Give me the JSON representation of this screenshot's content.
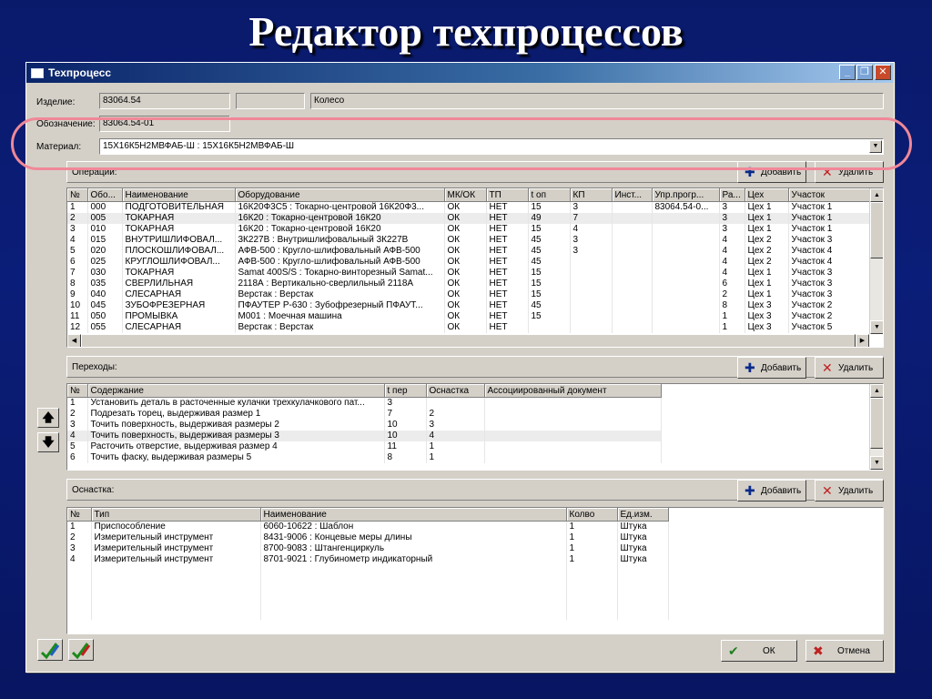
{
  "slide": {
    "title": "Редактор техпроцессов"
  },
  "window": {
    "title": "Техпроцесс"
  },
  "header": {
    "izdelie_label": "Изделие:",
    "izdelie_value": "83064.54",
    "izdelie_extra": "",
    "izdelie_name": "Колесо",
    "oboznachenie_label": "Обозначение:",
    "oboznachenie_value": "83064.54-01",
    "material_label": "Материал:",
    "material_value": "15Х16К5Н2МВФАБ-Ш : 15Х16К5Н2МВФАБ-Ш"
  },
  "buttons": {
    "add": "Добавить",
    "delete": "Удалить",
    "ok": "ОК",
    "cancel": "Отмена"
  },
  "operations": {
    "label": "Операции:",
    "columns": [
      "№",
      "Обо...",
      "Наименование",
      "Оборудование",
      "МК/ОК",
      "ТП",
      "t оп",
      "КП",
      "Инст...",
      "Упр.прогр...",
      "Ра...",
      "Цех",
      "Участок"
    ],
    "rows": [
      [
        "1",
        "000",
        "ПОДГОТОВИТЕЛЬНАЯ",
        "16К20Ф3С5 : Токарно-центровой 16К20Ф3...",
        "ОК",
        "НЕТ",
        "15",
        "3",
        "",
        "83064.54-0...",
        "3",
        "Цех 1",
        "Участок 1"
      ],
      [
        "2",
        "005",
        "ТОКАРНАЯ",
        "16К20 : Токарно-центровой 16К20",
        "ОК",
        "НЕТ",
        "49",
        "7",
        "",
        "",
        "3",
        "Цех 1",
        "Участок 1"
      ],
      [
        "3",
        "010",
        "ТОКАРНАЯ",
        "16К20 : Токарно-центровой 16К20",
        "ОК",
        "НЕТ",
        "15",
        "4",
        "",
        "",
        "3",
        "Цех 1",
        "Участок 1"
      ],
      [
        "4",
        "015",
        "ВНУТРИШЛИФОВАЛ...",
        "3К227В : Внутришлифовальный 3К227В",
        "ОК",
        "НЕТ",
        "45",
        "3",
        "",
        "",
        "4",
        "Цех 2",
        "Участок 3"
      ],
      [
        "5",
        "020",
        "ПЛОСКОШЛИФОВАЛ...",
        "АФВ-500 : Кругло-шлифовальный АФВ-500",
        "ОК",
        "НЕТ",
        "45",
        "3",
        "",
        "",
        "4",
        "Цех 2",
        "Участок 4"
      ],
      [
        "6",
        "025",
        "КРУГЛОШЛИФОВАЛ...",
        "АФВ-500 : Кругло-шлифовальный АФВ-500",
        "ОК",
        "НЕТ",
        "45",
        "",
        "",
        "",
        "4",
        "Цех 2",
        "Участок 4"
      ],
      [
        "7",
        "030",
        "ТОКАРНАЯ",
        "Samat 400S/S : Токарно-винторезный Samat...",
        "ОК",
        "НЕТ",
        "15",
        "",
        "",
        "",
        "4",
        "Цех 1",
        "Участок 3"
      ],
      [
        "8",
        "035",
        "СВЕРЛИЛЬНАЯ",
        "2118А : Вертикально-сверлильный 2118А",
        "ОК",
        "НЕТ",
        "15",
        "",
        "",
        "",
        "6",
        "Цех 1",
        "Участок 3"
      ],
      [
        "9",
        "040",
        "СЛЕСАРНАЯ",
        "Верстак : Верстак",
        "ОК",
        "НЕТ",
        "15",
        "",
        "",
        "",
        "2",
        "Цех 1",
        "Участок 3"
      ],
      [
        "10",
        "045",
        "ЗУБОФРЕЗЕРНАЯ",
        "ПФАУТЕР Р-630 : Зубофрезерный ПФАУТ...",
        "ОК",
        "НЕТ",
        "45",
        "",
        "",
        "",
        "8",
        "Цех 3",
        "Участок 2"
      ],
      [
        "11",
        "050",
        "ПРОМЫВКА",
        "М001 : Моечная машина",
        "ОК",
        "НЕТ",
        "15",
        "",
        "",
        "",
        "1",
        "Цех 3",
        "Участок 2"
      ],
      [
        "12",
        "055",
        "СЛЕСАРНАЯ",
        "Верстак : Верстак",
        "ОК",
        "НЕТ",
        "",
        "",
        "",
        "",
        "1",
        "Цех 3",
        "Участок 5"
      ]
    ]
  },
  "transitions": {
    "label": "Переходы:",
    "columns": [
      "№",
      "Содержание",
      "t пер",
      "Оснастка",
      "Ассоциированный документ"
    ],
    "rows": [
      [
        "1",
        "Установить деталь в расточенные кулачки трехкулачкового пат...",
        "3",
        "",
        ""
      ],
      [
        "2",
        "Подрезать торец, выдерживая размер 1",
        "7",
        "2",
        ""
      ],
      [
        "3",
        "Точить поверхность, выдерживая размеры 2",
        "10",
        "3",
        ""
      ],
      [
        "4",
        "Точить поверхность, выдерживая размеры 3",
        "10",
        "4",
        ""
      ],
      [
        "5",
        "Расточить отверстие, выдерживая размер 4",
        "11",
        "1",
        ""
      ],
      [
        "6",
        "Точить фаску, выдерживая размеры 5",
        "8",
        "1",
        ""
      ]
    ]
  },
  "tooling": {
    "label": "Оснастка:",
    "columns": [
      "№",
      "Тип",
      "Наименование",
      "Колво",
      "Ед.изм."
    ],
    "rows": [
      [
        "1",
        "Приспособление",
        "6060-10622 : Шаблон",
        "1",
        "Штука"
      ],
      [
        "2",
        "Измерительный инструмент",
        "8431-9006 : Концевые меры длины",
        "1",
        "Штука"
      ],
      [
        "3",
        "Измерительный инструмент",
        "8700-9083 : Штангенциркуль",
        "1",
        "Штука"
      ],
      [
        "4",
        "Измерительный инструмент",
        "8701-9021 : Глубинометр индикаторный",
        "1",
        "Штука"
      ]
    ]
  },
  "colors": {
    "window_bg": "#d4d0c8",
    "title_bar": "#0a246a",
    "slide_bg": "#0a1a6b",
    "highlight": "#f08898"
  }
}
